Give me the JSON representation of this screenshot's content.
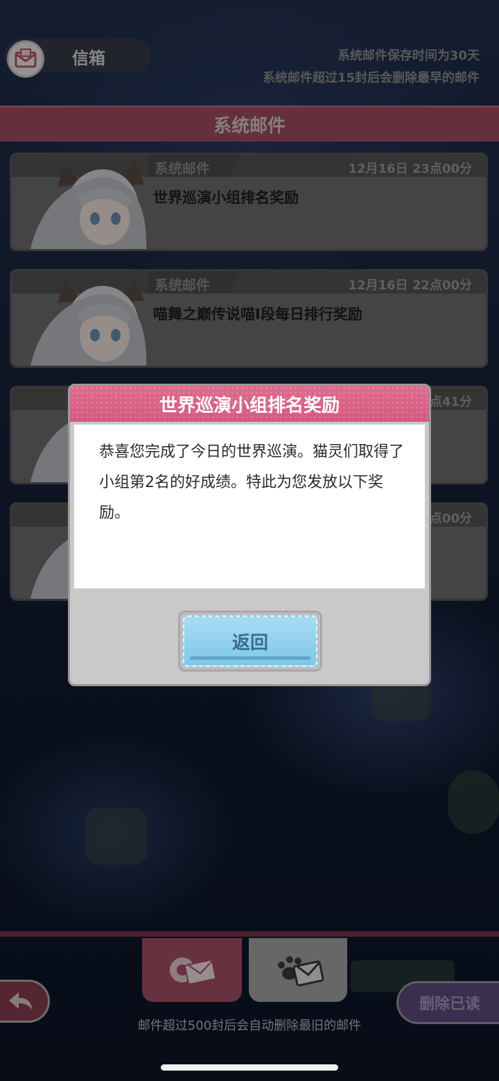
{
  "header": {
    "mailbox_title": "信箱",
    "notice_line1": "系统邮件保存时间为30天",
    "notice_line2": "系统邮件超过15封后会删除最早的邮件",
    "section_title": "系统邮件"
  },
  "mails": [
    {
      "tag": "系统邮件",
      "time": "12月16日 23点00分",
      "subject": "世界巡演小组排名奖励"
    },
    {
      "tag": "系统邮件",
      "time": "12月16日 22点00分",
      "subject": "喵舞之巅传说喵I段每日排行奖励"
    },
    {
      "tag": "",
      "time": "点41分",
      "subject": ""
    },
    {
      "tag": "",
      "time": "点00分",
      "subject": ""
    }
  ],
  "dialog": {
    "title": "世界巡演小组排名奖励",
    "body": "恭喜您完成了今日的世界巡演。猫灵们取得了小组第2名的好成绩。特此为您发放以下奖励。",
    "back_label": "返回"
  },
  "footer": {
    "delete_read_label": "删除已读",
    "note": "邮件超过500封后会自动删除最旧的邮件"
  },
  "colors": {
    "accent_pink": "#d45a80",
    "section_band": "#a34c63",
    "button_blue": "#7fc7ea",
    "delete_purple": "#5f4d80"
  },
  "icons": [
    "mail-icon",
    "system-mail-gear-icon",
    "friend-mail-paw-icon",
    "back-arrow-icon"
  ]
}
